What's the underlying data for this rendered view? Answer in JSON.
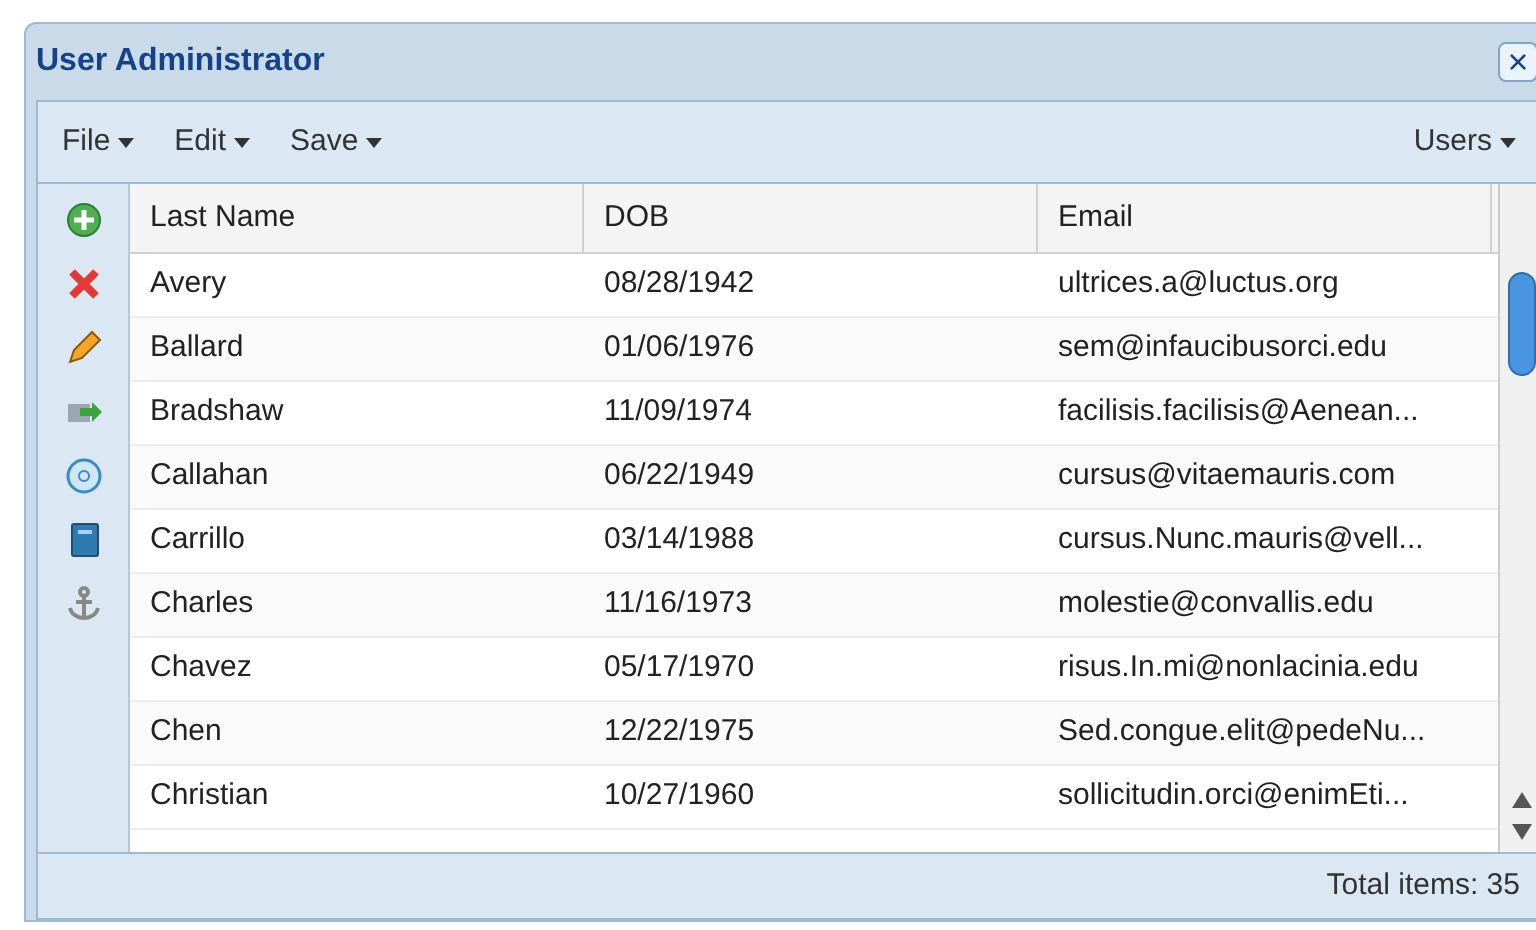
{
  "window": {
    "title": "User Administrator",
    "close": "×"
  },
  "menu": [
    {
      "label": "File"
    },
    {
      "label": "Edit"
    },
    {
      "label": "Save"
    }
  ],
  "menu_right": {
    "label": "Users"
  },
  "tools": [
    {
      "kind": "add"
    },
    {
      "kind": "delete"
    },
    {
      "kind": "edit"
    },
    {
      "kind": "move"
    },
    {
      "kind": "disc"
    },
    {
      "kind": "book"
    },
    {
      "kind": "anchor"
    }
  ],
  "table": {
    "columns": [
      "Last Name",
      "DOB",
      "Email"
    ],
    "rows": [
      [
        "Avery",
        "08/28/1942",
        "ultrices.a@luctus.org"
      ],
      [
        "Ballard",
        "01/06/1976",
        "sem@infaucibusorci.edu"
      ],
      [
        "Bradshaw",
        "11/09/1974",
        "facilisis.facilisis@Aenean..."
      ],
      [
        "Callahan",
        "06/22/1949",
        "cursus@vitaemauris.com"
      ],
      [
        "Carrillo",
        "03/14/1988",
        "cursus.Nunc.mauris@vell..."
      ],
      [
        "Charles",
        "11/16/1973",
        "molestie@convallis.edu"
      ],
      [
        "Chavez",
        "05/17/1970",
        "risus.In.mi@nonlacinia.edu"
      ],
      [
        "Chen",
        "12/22/1975",
        "Sed.congue.elit@pedeNu..."
      ],
      [
        "Christian",
        "10/27/1960",
        "sollicitudin.orci@enimEti..."
      ]
    ]
  },
  "status_bar": "Total items: 35"
}
